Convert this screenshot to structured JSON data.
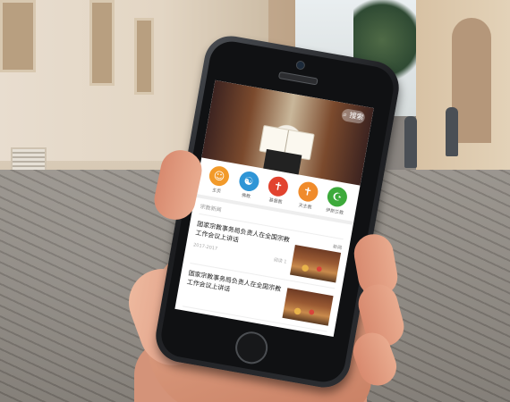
{
  "app": {
    "search_label": "搜索",
    "categories": [
      {
        "label": "主页",
        "color": "#f29a2a",
        "glyph": "☺"
      },
      {
        "label": "佛教",
        "color": "#2f95d6",
        "glyph": "☯"
      },
      {
        "label": "基督教",
        "color": "#e2432f",
        "glyph": "✝"
      },
      {
        "label": "天主教",
        "color": "#f08b2b",
        "glyph": "✝"
      },
      {
        "label": "伊斯兰教",
        "color": "#3daa3b",
        "glyph": "☪"
      }
    ],
    "section_title": "宗教新闻",
    "articles": [
      {
        "title": "国家宗教事务局负责人在全国宗教工作会议上讲话",
        "meta_left": "2017-2017",
        "meta_right": "阅读 1",
        "tag": "新闻"
      },
      {
        "title": "国家宗教事务局负责人在全国宗教工作会议上讲话",
        "meta_left": "",
        "meta_right": "",
        "tag": ""
      }
    ]
  }
}
